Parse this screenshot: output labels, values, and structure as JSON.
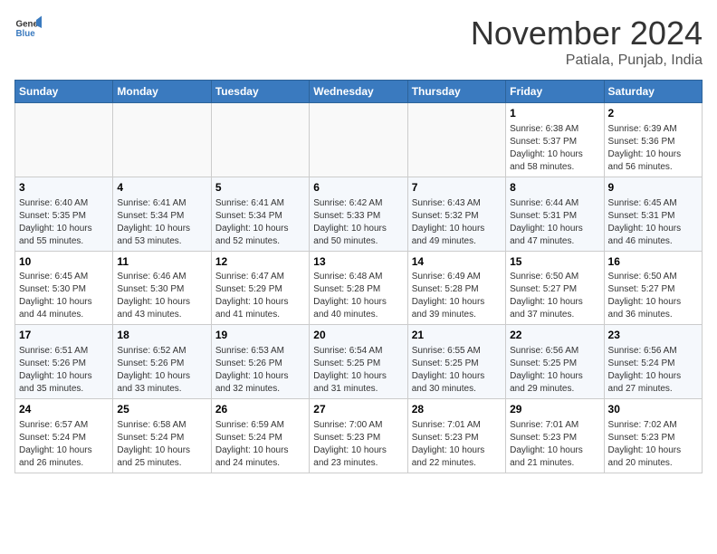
{
  "header": {
    "logo": {
      "general": "General",
      "blue": "Blue"
    },
    "title": "November 2024",
    "location": "Patiala, Punjab, India"
  },
  "calendar": {
    "days_of_week": [
      "Sunday",
      "Monday",
      "Tuesday",
      "Wednesday",
      "Thursday",
      "Friday",
      "Saturday"
    ],
    "weeks": [
      [
        {
          "day": "",
          "info": ""
        },
        {
          "day": "",
          "info": ""
        },
        {
          "day": "",
          "info": ""
        },
        {
          "day": "",
          "info": ""
        },
        {
          "day": "",
          "info": ""
        },
        {
          "day": "1",
          "info": "Sunrise: 6:38 AM\nSunset: 5:37 PM\nDaylight: 10 hours and 58 minutes."
        },
        {
          "day": "2",
          "info": "Sunrise: 6:39 AM\nSunset: 5:36 PM\nDaylight: 10 hours and 56 minutes."
        }
      ],
      [
        {
          "day": "3",
          "info": "Sunrise: 6:40 AM\nSunset: 5:35 PM\nDaylight: 10 hours and 55 minutes."
        },
        {
          "day": "4",
          "info": "Sunrise: 6:41 AM\nSunset: 5:34 PM\nDaylight: 10 hours and 53 minutes."
        },
        {
          "day": "5",
          "info": "Sunrise: 6:41 AM\nSunset: 5:34 PM\nDaylight: 10 hours and 52 minutes."
        },
        {
          "day": "6",
          "info": "Sunrise: 6:42 AM\nSunset: 5:33 PM\nDaylight: 10 hours and 50 minutes."
        },
        {
          "day": "7",
          "info": "Sunrise: 6:43 AM\nSunset: 5:32 PM\nDaylight: 10 hours and 49 minutes."
        },
        {
          "day": "8",
          "info": "Sunrise: 6:44 AM\nSunset: 5:31 PM\nDaylight: 10 hours and 47 minutes."
        },
        {
          "day": "9",
          "info": "Sunrise: 6:45 AM\nSunset: 5:31 PM\nDaylight: 10 hours and 46 minutes."
        }
      ],
      [
        {
          "day": "10",
          "info": "Sunrise: 6:45 AM\nSunset: 5:30 PM\nDaylight: 10 hours and 44 minutes."
        },
        {
          "day": "11",
          "info": "Sunrise: 6:46 AM\nSunset: 5:30 PM\nDaylight: 10 hours and 43 minutes."
        },
        {
          "day": "12",
          "info": "Sunrise: 6:47 AM\nSunset: 5:29 PM\nDaylight: 10 hours and 41 minutes."
        },
        {
          "day": "13",
          "info": "Sunrise: 6:48 AM\nSunset: 5:28 PM\nDaylight: 10 hours and 40 minutes."
        },
        {
          "day": "14",
          "info": "Sunrise: 6:49 AM\nSunset: 5:28 PM\nDaylight: 10 hours and 39 minutes."
        },
        {
          "day": "15",
          "info": "Sunrise: 6:50 AM\nSunset: 5:27 PM\nDaylight: 10 hours and 37 minutes."
        },
        {
          "day": "16",
          "info": "Sunrise: 6:50 AM\nSunset: 5:27 PM\nDaylight: 10 hours and 36 minutes."
        }
      ],
      [
        {
          "day": "17",
          "info": "Sunrise: 6:51 AM\nSunset: 5:26 PM\nDaylight: 10 hours and 35 minutes."
        },
        {
          "day": "18",
          "info": "Sunrise: 6:52 AM\nSunset: 5:26 PM\nDaylight: 10 hours and 33 minutes."
        },
        {
          "day": "19",
          "info": "Sunrise: 6:53 AM\nSunset: 5:26 PM\nDaylight: 10 hours and 32 minutes."
        },
        {
          "day": "20",
          "info": "Sunrise: 6:54 AM\nSunset: 5:25 PM\nDaylight: 10 hours and 31 minutes."
        },
        {
          "day": "21",
          "info": "Sunrise: 6:55 AM\nSunset: 5:25 PM\nDaylight: 10 hours and 30 minutes."
        },
        {
          "day": "22",
          "info": "Sunrise: 6:56 AM\nSunset: 5:25 PM\nDaylight: 10 hours and 29 minutes."
        },
        {
          "day": "23",
          "info": "Sunrise: 6:56 AM\nSunset: 5:24 PM\nDaylight: 10 hours and 27 minutes."
        }
      ],
      [
        {
          "day": "24",
          "info": "Sunrise: 6:57 AM\nSunset: 5:24 PM\nDaylight: 10 hours and 26 minutes."
        },
        {
          "day": "25",
          "info": "Sunrise: 6:58 AM\nSunset: 5:24 PM\nDaylight: 10 hours and 25 minutes."
        },
        {
          "day": "26",
          "info": "Sunrise: 6:59 AM\nSunset: 5:24 PM\nDaylight: 10 hours and 24 minutes."
        },
        {
          "day": "27",
          "info": "Sunrise: 7:00 AM\nSunset: 5:23 PM\nDaylight: 10 hours and 23 minutes."
        },
        {
          "day": "28",
          "info": "Sunrise: 7:01 AM\nSunset: 5:23 PM\nDaylight: 10 hours and 22 minutes."
        },
        {
          "day": "29",
          "info": "Sunrise: 7:01 AM\nSunset: 5:23 PM\nDaylight: 10 hours and 21 minutes."
        },
        {
          "day": "30",
          "info": "Sunrise: 7:02 AM\nSunset: 5:23 PM\nDaylight: 10 hours and 20 minutes."
        }
      ]
    ]
  }
}
